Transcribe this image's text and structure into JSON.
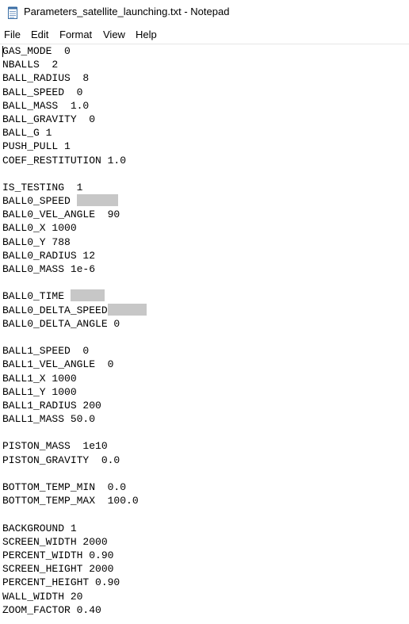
{
  "window": {
    "title": "Parameters_satellite_launching.txt - Notepad",
    "app_icon": "notepad-icon"
  },
  "menu": {
    "file": "File",
    "edit": "Edit",
    "format": "Format",
    "view": "View",
    "help": "Help"
  },
  "editor": {
    "lines": [
      {
        "text": "GAS_MODE  0"
      },
      {
        "text": "NBALLS  2"
      },
      {
        "text": "BALL_RADIUS  8"
      },
      {
        "text": "BALL_SPEED  0"
      },
      {
        "text": "BALL_MASS  1.0"
      },
      {
        "text": "BALL_GRAVITY  0"
      },
      {
        "text": "BALL_G 1"
      },
      {
        "text": "PUSH_PULL 1"
      },
      {
        "text": "COEF_RESTITUTION 1.0"
      },
      {
        "text": ""
      },
      {
        "text": "IS_TESTING  1"
      },
      {
        "text": "BALL0_SPEED ",
        "redacted": true
      },
      {
        "text": "BALL0_VEL_ANGLE  90"
      },
      {
        "text": "BALL0_X 1000"
      },
      {
        "text": "BALL0_Y 788"
      },
      {
        "text": "BALL0_RADIUS 12"
      },
      {
        "text": "BALL0_MASS 1e-6"
      },
      {
        "text": ""
      },
      {
        "text": "BALL0_TIME ",
        "redacted": true
      },
      {
        "text": "BALL0_DELTA_SPEED",
        "redacted": true
      },
      {
        "text": "BALL0_DELTA_ANGLE 0"
      },
      {
        "text": ""
      },
      {
        "text": "BALL1_SPEED  0"
      },
      {
        "text": "BALL1_VEL_ANGLE  0"
      },
      {
        "text": "BALL1_X 1000"
      },
      {
        "text": "BALL1_Y 1000"
      },
      {
        "text": "BALL1_RADIUS 200"
      },
      {
        "text": "BALL1_MASS 50.0"
      },
      {
        "text": ""
      },
      {
        "text": "PISTON_MASS  1e10"
      },
      {
        "text": "PISTON_GRAVITY  0.0"
      },
      {
        "text": ""
      },
      {
        "text": "BOTTOM_TEMP_MIN  0.0"
      },
      {
        "text": "BOTTOM_TEMP_MAX  100.0"
      },
      {
        "text": ""
      },
      {
        "text": "BACKGROUND 1"
      },
      {
        "text": "SCREEN_WIDTH 2000"
      },
      {
        "text": "PERCENT_WIDTH 0.90"
      },
      {
        "text": "SCREEN_HEIGHT 2000"
      },
      {
        "text": "PERCENT_HEIGHT 0.90"
      },
      {
        "text": "WALL_WIDTH 20"
      },
      {
        "text": "ZOOM_FACTOR 0.40"
      }
    ]
  },
  "colors": {
    "background": "#ffffff",
    "text": "#000000",
    "redaction": "#c7c7c7"
  }
}
